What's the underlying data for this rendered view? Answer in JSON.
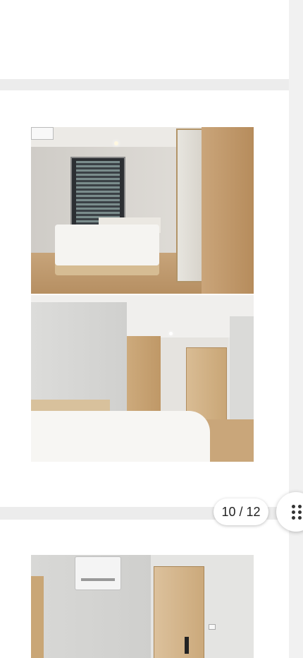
{
  "gallery": {
    "photos": [
      {
        "icon": "bedroom-window-photo"
      },
      {
        "icon": "bedroom-door-photo"
      },
      {
        "icon": "air-conditioner-door-photo"
      }
    ],
    "counter": {
      "current": 10,
      "total": 12,
      "text": "10 / 12"
    },
    "menu_icon": "grid-dots-icon"
  }
}
